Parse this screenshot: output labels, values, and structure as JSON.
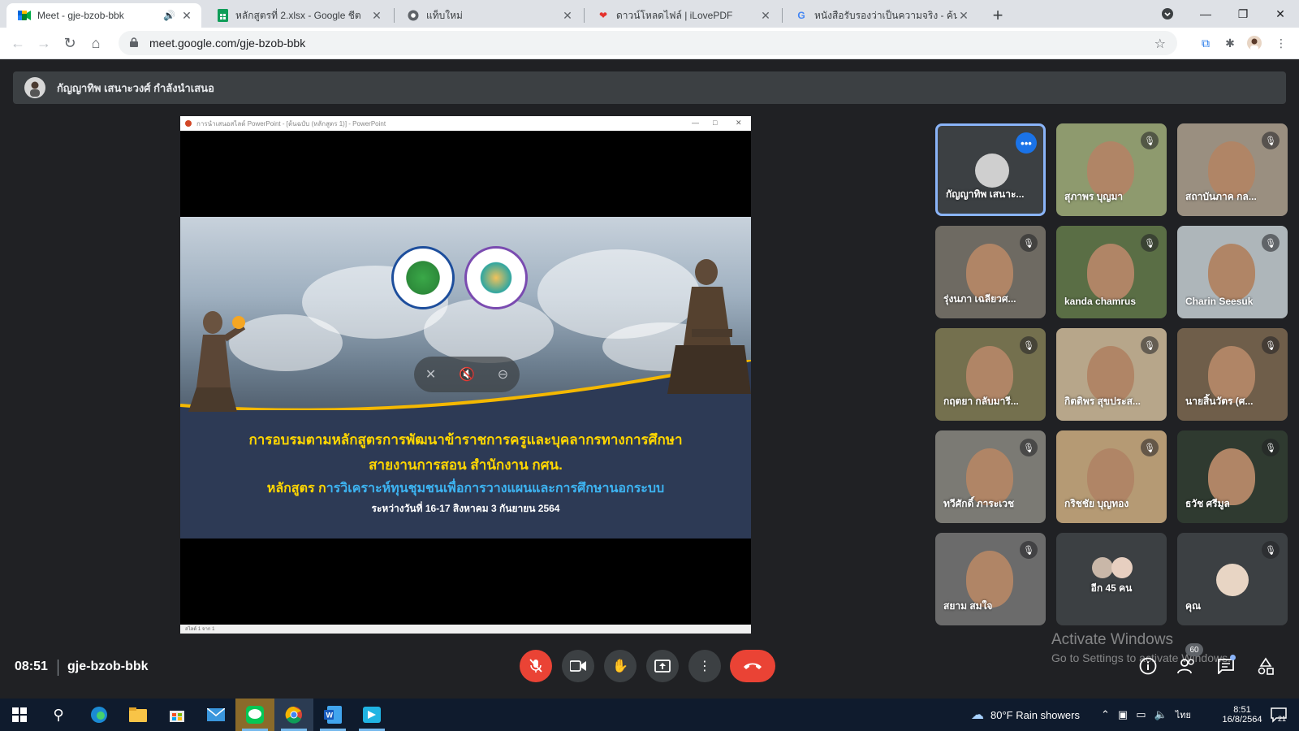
{
  "browser": {
    "tabs": [
      {
        "title": "Meet - gje-bzob-bbk",
        "icon": "google-meet-icon",
        "active": true,
        "audio": true
      },
      {
        "title": "หลักสูตรที่ 2.xlsx - Google ชีต",
        "icon": "google-sheets-icon"
      },
      {
        "title": "แท็บใหม่",
        "icon": "chrome-icon"
      },
      {
        "title": "ดาวน์โหลดไฟล์ | iLovePDF",
        "icon": "ilovepdf-heart-icon"
      },
      {
        "title": "หนังสือรับรองว่าเป็นความจริง - ค้นหาด้",
        "icon": "google-g-icon"
      }
    ],
    "new_tab_symbol": "+",
    "url": "meet.google.com/gje-bzob-bbk"
  },
  "meet": {
    "presenter_banner": "กัญญาทิพ เสนาะวงศ์ กำลังนำเสนอ",
    "presentation_window_title": "การนำเสนอสไลด์ PowerPoint - [ต้นฉบับ (หลักสูตร 1)] - PowerPoint",
    "slide": {
      "line1": "การอบรมตามหลักสูตรการพัฒนาข้าราชการครูและบุคลากรทางการศึกษา",
      "line2": "สายงานการสอน สำนักงาน กศน.",
      "line3_prefix": "หลักสูตร ก",
      "line3_main": "ารวิเคราะห์ทุนชุมชนเพื่อการวางแผนและการศึกษานอกระบบ",
      "line4": "ระหว่างวันที่ 16-17 สิงหาคม 3 กันยายน 2564"
    },
    "pp_status": "สไลด์ 1 จาก 1",
    "participants": [
      {
        "name": "กัญญาทิพ เสนาะ...",
        "selected": true,
        "muted": false,
        "bg": "#3c4043",
        "avatar": true
      },
      {
        "name": "สุภาพร บุญมา",
        "muted": true,
        "bg": "#8e9a6e"
      },
      {
        "name": "สถาบันภาค กล...",
        "muted": true,
        "bg": "#9a8f80"
      },
      {
        "name": "รุ่งนภา เฉลียวศ...",
        "muted": true,
        "bg": "#6e6a62"
      },
      {
        "name": "kanda chamrus",
        "muted": true,
        "bg": "#5a6e45"
      },
      {
        "name": "Charin Seesuk",
        "muted": true,
        "bg": "#aeb6ba"
      },
      {
        "name": "กฤตยา กลับมารี...",
        "muted": true,
        "bg": "#74704e"
      },
      {
        "name": "กิตติพร สุขประส...",
        "muted": true,
        "bg": "#b7a68a"
      },
      {
        "name": "นายสิ้นวัตร (ศ...",
        "muted": true,
        "bg": "#6f5e4a"
      },
      {
        "name": "ทวีศักดิ์ ภาระเวช",
        "muted": true,
        "bg": "#7b7a74"
      },
      {
        "name": "กริชชัย บุญทอง",
        "muted": true,
        "bg": "#b59a74"
      },
      {
        "name": "ธวัช ศรีมูล",
        "muted": true,
        "bg": "#2f3a30"
      },
      {
        "name": "สยาม สมใจ",
        "muted": true,
        "bg": "#6b6b6b"
      },
      {
        "name": "อีก 45 คน",
        "muted": false,
        "bg": "#3c4043",
        "others": true
      },
      {
        "name": "คุณ",
        "muted": true,
        "bg": "#3c4043",
        "self": true
      }
    ],
    "time": "08:51",
    "meeting_code": "gje-bzob-bbk",
    "participants_count": "60",
    "activate_windows_title": "Activate Windows",
    "activate_windows_sub": "Go to Settings to activate Windows."
  },
  "taskbar": {
    "weather": "80°F  Rain showers",
    "lang": "ไทย",
    "time": "8:51",
    "date": "16/8/2564",
    "notifications": "21"
  }
}
